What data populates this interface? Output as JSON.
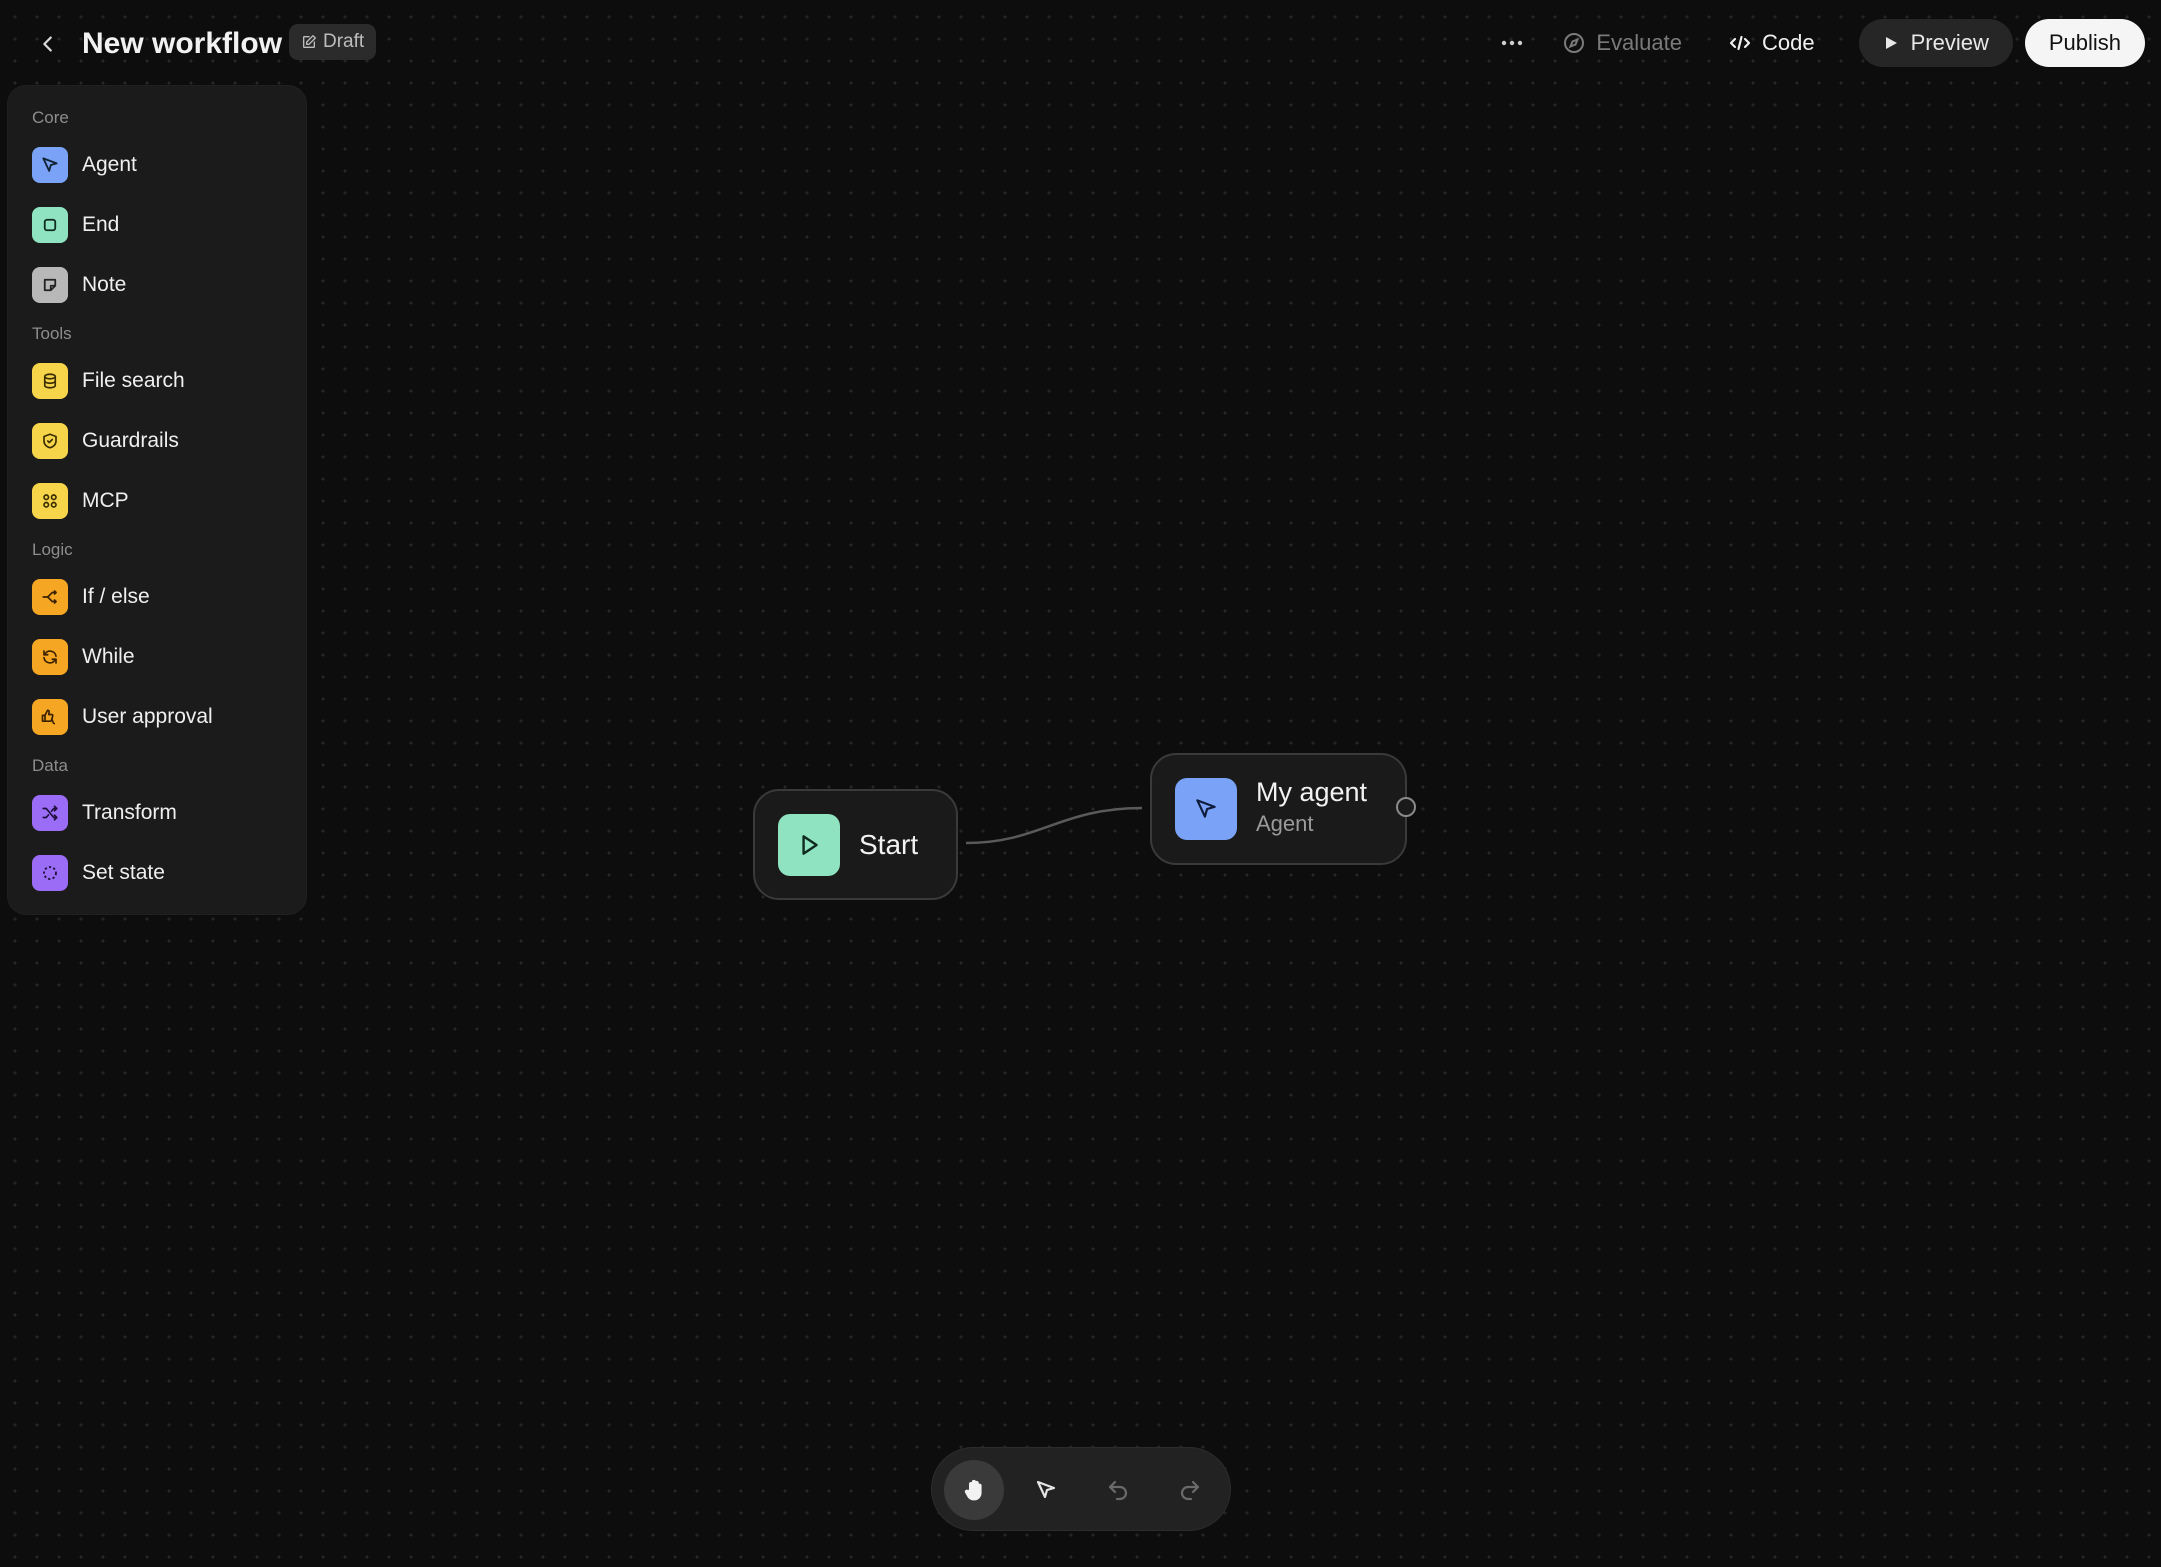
{
  "header": {
    "title": "New workflow",
    "draft_badge": "Draft",
    "evaluate_label": "Evaluate",
    "code_label": "Code",
    "preview_label": "Preview",
    "publish_label": "Publish"
  },
  "palette": {
    "sections": {
      "core": "Core",
      "tools": "Tools",
      "logic": "Logic",
      "data": "Data"
    },
    "items": {
      "agent": "Agent",
      "end": "End",
      "note": "Note",
      "file_search": "File search",
      "guardrails": "Guardrails",
      "mcp": "MCP",
      "if_else": "If / else",
      "while": "While",
      "user_approval": "User approval",
      "transform": "Transform",
      "set_state": "Set state"
    }
  },
  "nodes": {
    "start": {
      "title": "Start"
    },
    "agent": {
      "title": "My agent",
      "subtitle": "Agent"
    }
  },
  "colors": {
    "core_agent": "#7aa3f7",
    "core_end": "#8fe3c0",
    "core_note": "#b8b8b8",
    "tools": "#f7d54a",
    "logic": "#f5a623",
    "data": "#9b6cf6"
  }
}
